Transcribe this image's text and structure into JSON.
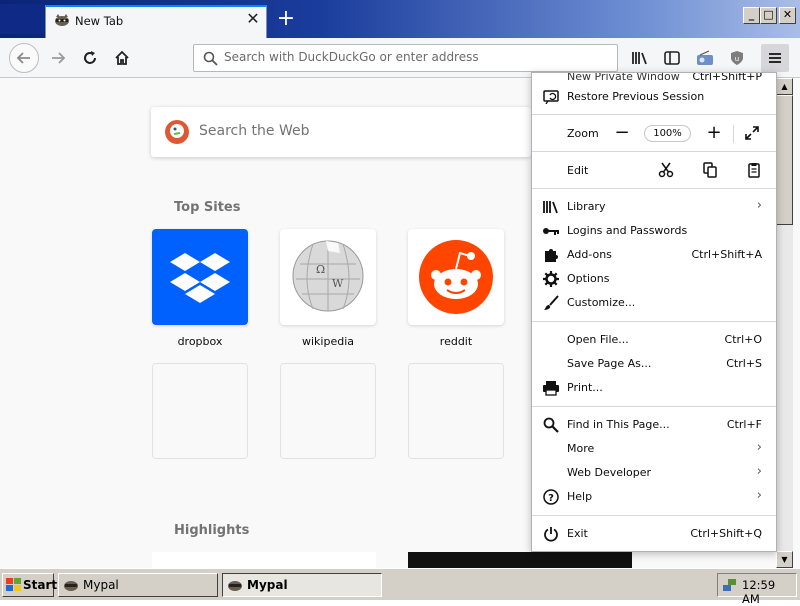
{
  "window": {
    "tab_title": "New Tab",
    "tab_close_glyph": "✕",
    "new_tab_glyph": "+",
    "minimize_glyph": "_",
    "maximize_glyph": "□",
    "close_glyph": "✕"
  },
  "nav": {
    "url_placeholder": "Search with DuckDuckGo or enter address"
  },
  "newtab": {
    "search_placeholder": "Search the Web",
    "top_sites_title": "Top Sites",
    "highlights_title": "Highlights",
    "sites": [
      {
        "label": "dropbox",
        "color": "#0061fe"
      },
      {
        "label": "wikipedia",
        "color": "#ffffff"
      },
      {
        "label": "reddit",
        "color": "#ff4500"
      }
    ]
  },
  "menu": {
    "partial_item": "New Private Window",
    "partial_shortcut": "Ctrl+Shift+P",
    "restore_session": "Restore Previous Session",
    "zoom_label": "Zoom",
    "zoom_minus": "−",
    "zoom_value": "100%",
    "zoom_plus": "+",
    "edit_label": "Edit",
    "items_group1": [
      {
        "label": "Library",
        "chevron": "›",
        "icon": "library-icon"
      },
      {
        "label": "Logins and Passwords",
        "icon": "key-icon"
      },
      {
        "label": "Add-ons",
        "shortcut": "Ctrl+Shift+A",
        "icon": "puzzle-icon"
      },
      {
        "label": "Options",
        "icon": "gear-icon"
      },
      {
        "label": "Customize...",
        "icon": "paintbrush-icon"
      }
    ],
    "items_group2": [
      {
        "label": "Open File...",
        "shortcut": "Ctrl+O"
      },
      {
        "label": "Save Page As...",
        "shortcut": "Ctrl+S"
      },
      {
        "label": "Print...",
        "icon": "printer-icon"
      }
    ],
    "items_group3": [
      {
        "label": "Find in This Page...",
        "shortcut": "Ctrl+F",
        "icon": "search-icon"
      },
      {
        "label": "More",
        "chevron": "›"
      },
      {
        "label": "Web Developer",
        "chevron": "›"
      },
      {
        "label": "Help",
        "chevron": "›",
        "icon": "help-icon"
      }
    ],
    "exit": {
      "label": "Exit",
      "shortcut": "Ctrl+Shift+Q"
    }
  },
  "taskbar": {
    "start_label": "Start",
    "tasks": [
      "Mypal",
      "Mypal"
    ],
    "clock": "12:59 AM"
  }
}
